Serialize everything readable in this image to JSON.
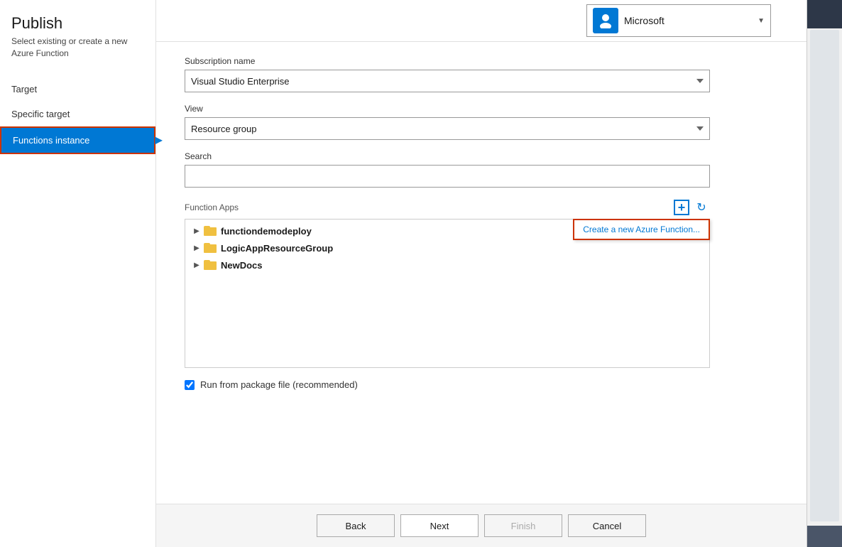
{
  "sidebar": {
    "title": "Publish",
    "subtitle": "Select existing or create a new Azure Function",
    "nav_items": [
      {
        "id": "target",
        "label": "Target"
      },
      {
        "id": "specific-target",
        "label": "Specific target"
      },
      {
        "id": "functions-instance",
        "label": "Functions instance",
        "active": true
      }
    ]
  },
  "header": {
    "account_name": "Microsoft",
    "account_icon": "person-icon"
  },
  "form": {
    "subscription_label": "Subscription name",
    "subscription_value": "Visual Studio Enterprise",
    "subscription_placeholder": "Visual Studio Enterprise",
    "view_label": "View",
    "view_value": "Resource group",
    "search_label": "Search",
    "search_placeholder": "",
    "function_apps_label": "Function Apps",
    "add_tooltip": "Create a new Azure Function...",
    "tree_items": [
      {
        "id": "functiondemodeploy",
        "label": "functiondemodeploy"
      },
      {
        "id": "LogicAppResourceGroup",
        "label": "LogicAppResourceGroup"
      },
      {
        "id": "NewDocs",
        "label": "NewDocs"
      }
    ],
    "checkbox_label": "Run from package file (recommended)",
    "checkbox_checked": true
  },
  "buttons": {
    "back": "Back",
    "next": "Next",
    "finish": "Finish",
    "cancel": "Cancel"
  }
}
